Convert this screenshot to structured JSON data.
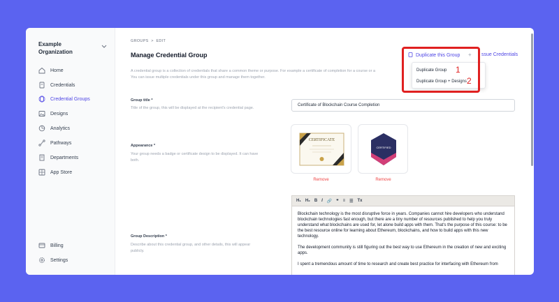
{
  "sidebar": {
    "org": "Example Organization",
    "items": [
      {
        "label": "Home",
        "icon": "home-icon"
      },
      {
        "label": "Credentials",
        "icon": "document-icon"
      },
      {
        "label": "Credential Groups",
        "icon": "stack-icon",
        "active": true
      },
      {
        "label": "Designs",
        "icon": "image-icon"
      },
      {
        "label": "Analytics",
        "icon": "chart-icon"
      },
      {
        "label": "Pathways",
        "icon": "route-icon"
      },
      {
        "label": "Departments",
        "icon": "building-icon"
      },
      {
        "label": "App Store",
        "icon": "grid-icon"
      }
    ],
    "bottom": [
      {
        "label": "Billing",
        "icon": "card-icon"
      },
      {
        "label": "Settings",
        "icon": "gear-icon"
      }
    ]
  },
  "header": {
    "crumb1": "GROUPS",
    "crumb_sep": ">",
    "crumb2": "EDIT",
    "title": "Manage Credential Group",
    "description_line1": "A credential group is a collection of credentials that share a common theme or purpose. For example a certificate of completion for a course or a",
    "description_line2": "You can issue multiple credentials under this group and manage them together.",
    "duplicate_label": "Duplicate this Group",
    "plus": "+",
    "issue_label": "ssue Credentials"
  },
  "menu": {
    "items": [
      "Duplicate Group",
      "Duplicate Group + Designs"
    ],
    "markers": [
      "1",
      "2"
    ]
  },
  "form": {
    "title_label": "Group title *",
    "title_help": "Title of the group, this will be displayed at the recipient's credential page.",
    "title_value": "Certificate of Blockchain Course Completion",
    "appearance_label": "Appearance *",
    "appearance_help1": "Your group needs a badge or certificate design to be displayed. It can have",
    "appearance_help2": "both.",
    "remove_label": "Remove",
    "certificate_text": "CERTIFICATE",
    "badge_text": "CERTIFIED",
    "description_label": "Group Description *",
    "description_help1": "Describe about this credential group, and other details, this will appear",
    "description_help2": "publicly.",
    "toolbar": [
      "H₁",
      "H₂",
      "B",
      "I",
      "🔗",
      "❞",
      "≡",
      "☰",
      "Tx"
    ],
    "editor_p1": "Blockchain technology is the most disruptive force in years. Companies cannot hire developers who understand blockchain technologies fast enough, but there are a tiny number of resources published to help you truly understand what blockchains are used for, let alone build apps with them. That's the purpose of this course: to be the best resource online for learning about Ethereum, blockchains, and how to build apps with this new technology.",
    "editor_p2": "The development community is still figuring out the best way to use Ethereum in the creation of new and exciting apps.",
    "editor_p3": "I spent a tremendous amount of time to research and create best practice for interfacing with Ethereum from"
  },
  "colors": {
    "accent": "#4f46e5",
    "background": "#5b63f0",
    "highlight": "#e02020",
    "remove": "#ef4444"
  }
}
